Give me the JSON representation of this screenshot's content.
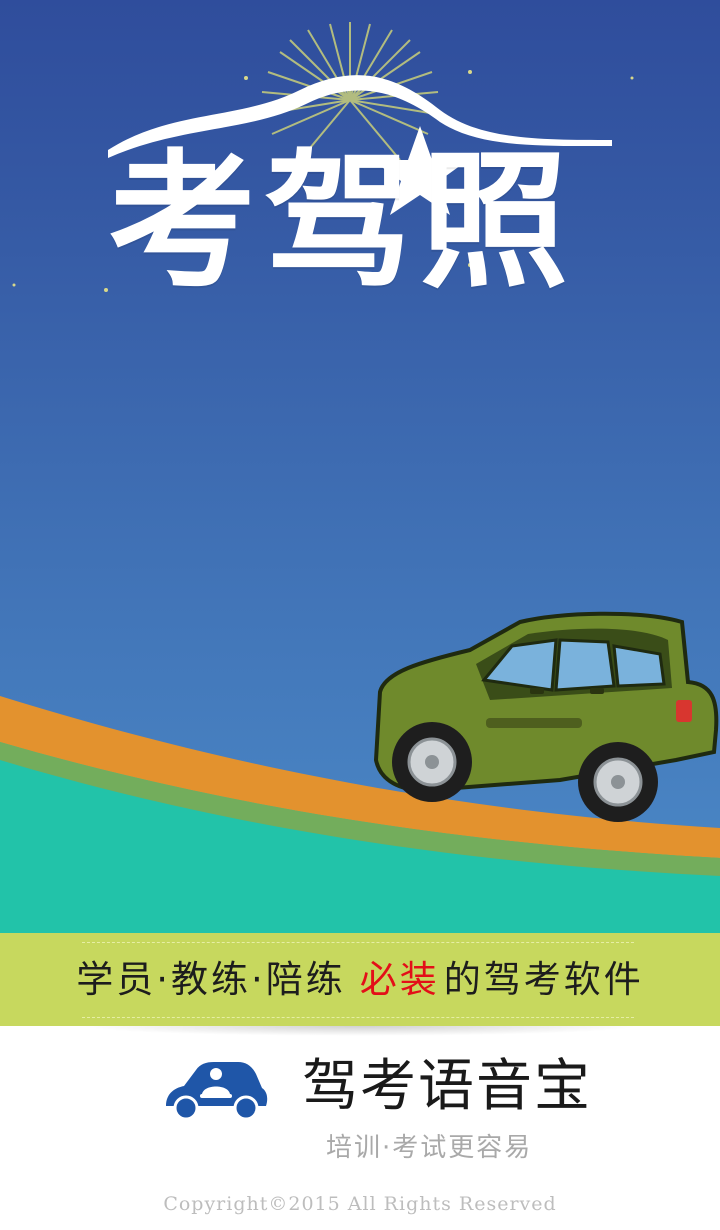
{
  "hero": {
    "logo_text": "考驾照"
  },
  "banner": {
    "tagline_prefix": "学员·教练·陪练",
    "tagline_highlight": "必装",
    "tagline_suffix": "的驾考软件"
  },
  "brand": {
    "app_name": "驾考语音宝",
    "slogan": "培训·考试更容易",
    "icon": "car-driver-icon"
  },
  "footer": {
    "copyright": "Copyright©2015 All Rights Reserved"
  },
  "colors": {
    "sky_top": "#2f4d9c",
    "sky_bottom": "#4c8bc8",
    "road_orange": "#e3922e",
    "ground_teal": "#22c3a9",
    "banner_green": "#c7d85e",
    "highlight_red": "#e30f18",
    "car_body": "#6f8a2c",
    "icon_blue": "#1f56a8"
  }
}
